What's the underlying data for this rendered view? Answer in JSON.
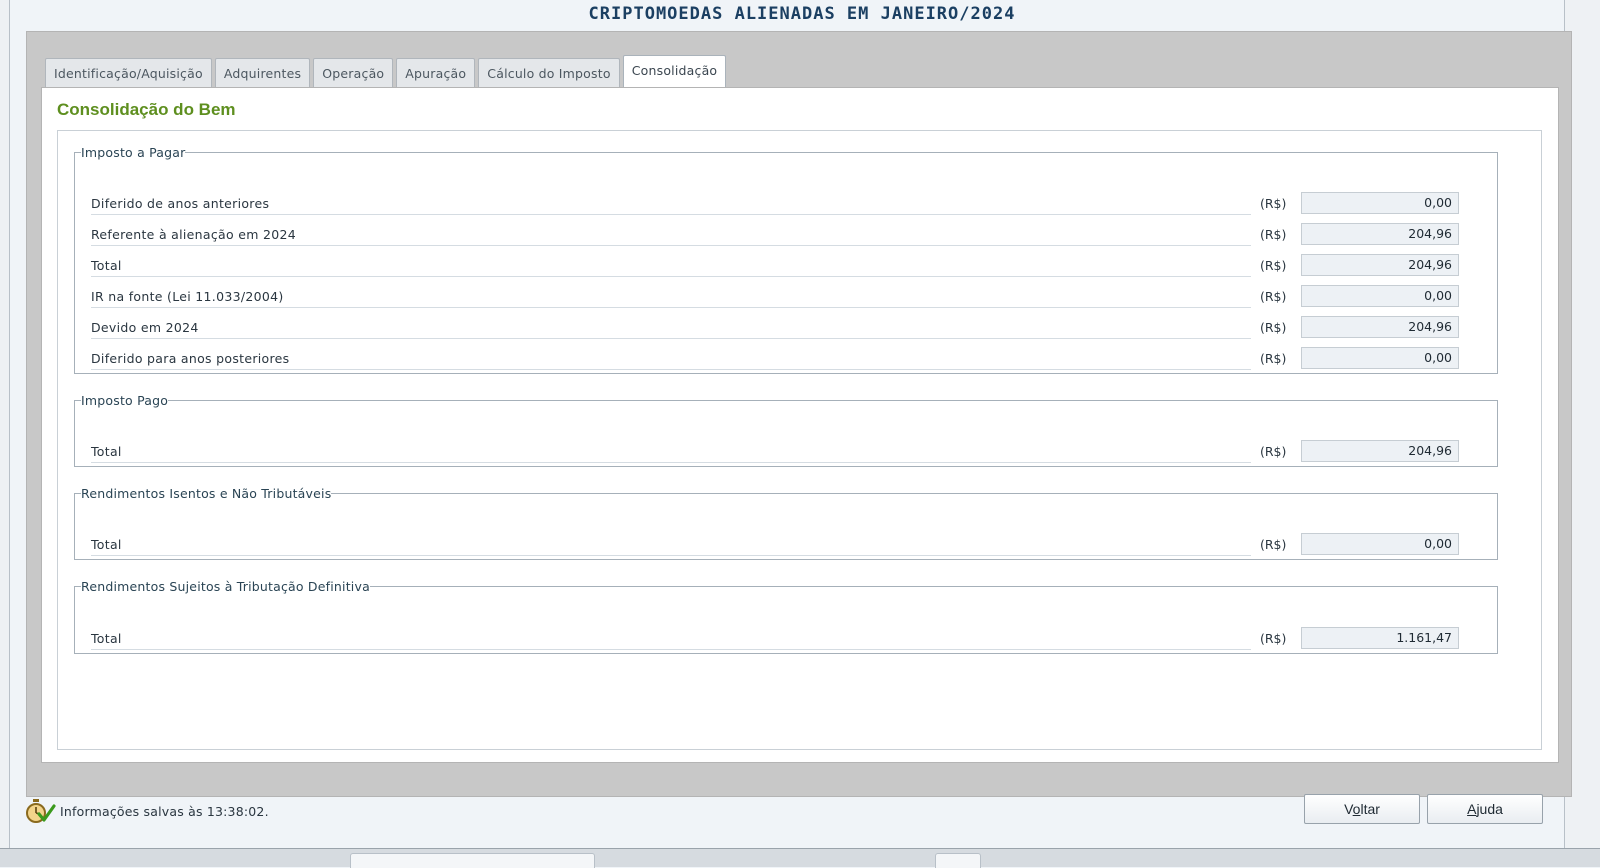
{
  "window_title": "CRIPTOMOEDAS ALIENADAS EM JANEIRO/2024",
  "tabs": [
    {
      "label": "Identificação/Aquisição",
      "active": false
    },
    {
      "label": "Adquirentes",
      "active": false
    },
    {
      "label": "Operação",
      "active": false
    },
    {
      "label": "Apuração",
      "active": false
    },
    {
      "label": "Cálculo do Imposto",
      "active": false
    },
    {
      "label": "Consolidação",
      "active": true
    }
  ],
  "section_title": "Consolidação do Bem",
  "groups": {
    "imposto_a_pagar": {
      "legend": "Imposto a Pagar",
      "rows": [
        {
          "label": "Diferido de anos anteriores",
          "currency": "(R$)",
          "value": "0,00"
        },
        {
          "label": "Referente à  alienação em 2024",
          "currency": "(R$)",
          "value": "204,96"
        },
        {
          "label": "Total",
          "currency": "(R$)",
          "value": "204,96"
        },
        {
          "label": "IR na fonte (Lei 11.033/2004)",
          "currency": "(R$)",
          "value": "0,00"
        },
        {
          "label": "Devido em 2024",
          "currency": "(R$)",
          "value": "204,96"
        },
        {
          "label": "Diferido para anos posteriores",
          "currency": "(R$)",
          "value": "0,00"
        }
      ]
    },
    "imposto_pago": {
      "legend": "Imposto Pago",
      "rows": [
        {
          "label": "Total",
          "currency": "(R$)",
          "value": "204,96"
        }
      ]
    },
    "rendimentos_isentos": {
      "legend": "Rendimentos Isentos e Não Tributáveis",
      "rows": [
        {
          "label": "Total",
          "currency": "(R$)",
          "value": "0,00"
        }
      ]
    },
    "rendimentos_sujeitos": {
      "legend": "Rendimentos Sujeitos à Tributação Definitiva",
      "rows": [
        {
          "label": "Total",
          "currency": "(R$)",
          "value": "1.161,47"
        }
      ]
    }
  },
  "status": {
    "icon": "stopwatch-check-icon",
    "message": "Informações salvas às 13:38:02."
  },
  "buttons": {
    "voltar": {
      "pre": "V",
      "mnemonic": "o",
      "post": "ltar"
    },
    "ajuda": {
      "pre": "",
      "mnemonic": "A",
      "post": "juda"
    }
  }
}
